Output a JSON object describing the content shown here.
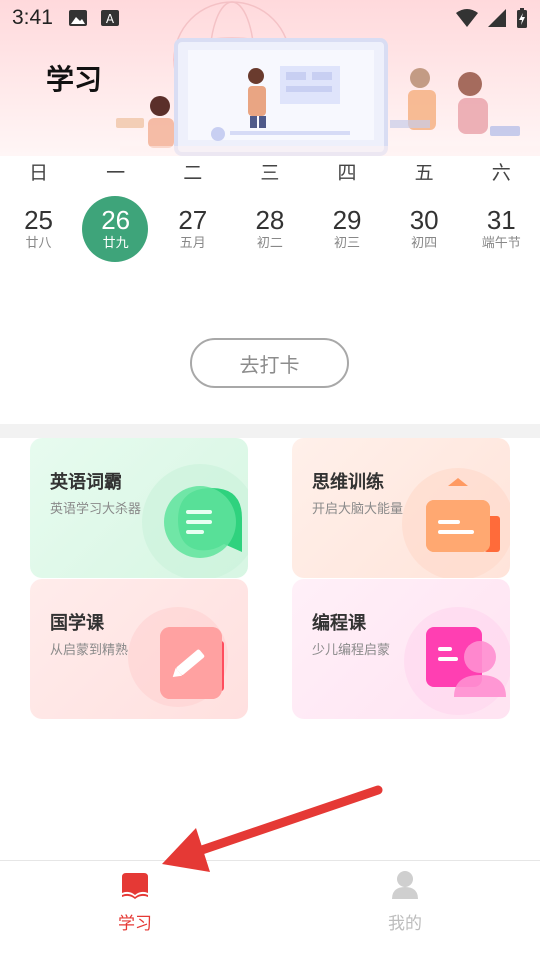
{
  "status_bar": {
    "time": "3:41"
  },
  "header": {
    "title": "学习"
  },
  "calendar": {
    "weekdays": [
      "日",
      "一",
      "二",
      "三",
      "四",
      "五",
      "六"
    ],
    "days": [
      {
        "num": "25",
        "lunar": "廿八"
      },
      {
        "num": "26",
        "lunar": "廿九",
        "selected": true
      },
      {
        "num": "27",
        "lunar": "五月"
      },
      {
        "num": "28",
        "lunar": "初二"
      },
      {
        "num": "29",
        "lunar": "初三"
      },
      {
        "num": "30",
        "lunar": "初四"
      },
      {
        "num": "31",
        "lunar": "端午节"
      }
    ],
    "selected_color": "#3ea47a"
  },
  "checkin_button": "去打卡",
  "courses": [
    {
      "title": "英语词霸",
      "subtitle": "英语学习大杀器",
      "icon": "chat-bubble-icon",
      "color": "#28d07a"
    },
    {
      "title": "思维训练",
      "subtitle": "开启大脑大能量",
      "icon": "presentation-board-icon",
      "color": "#ff8a4c"
    },
    {
      "title": "国学课",
      "subtitle": "从启蒙到精熟",
      "icon": "pencil-note-icon",
      "color": "#ff5e6c"
    },
    {
      "title": "编程课",
      "subtitle": "少儿编程启蒙",
      "icon": "user-card-icon",
      "color": "#ff3fb2"
    }
  ],
  "bottom_nav": {
    "tabs": [
      {
        "label": "学习",
        "icon": "book-icon",
        "active": true
      },
      {
        "label": "我的",
        "icon": "person-icon",
        "active": false
      }
    ],
    "active_color": "#e53935",
    "inactive_color": "#bdbdbd"
  },
  "annotation": {
    "icon": "red-arrow-icon",
    "color": "#e53935"
  }
}
